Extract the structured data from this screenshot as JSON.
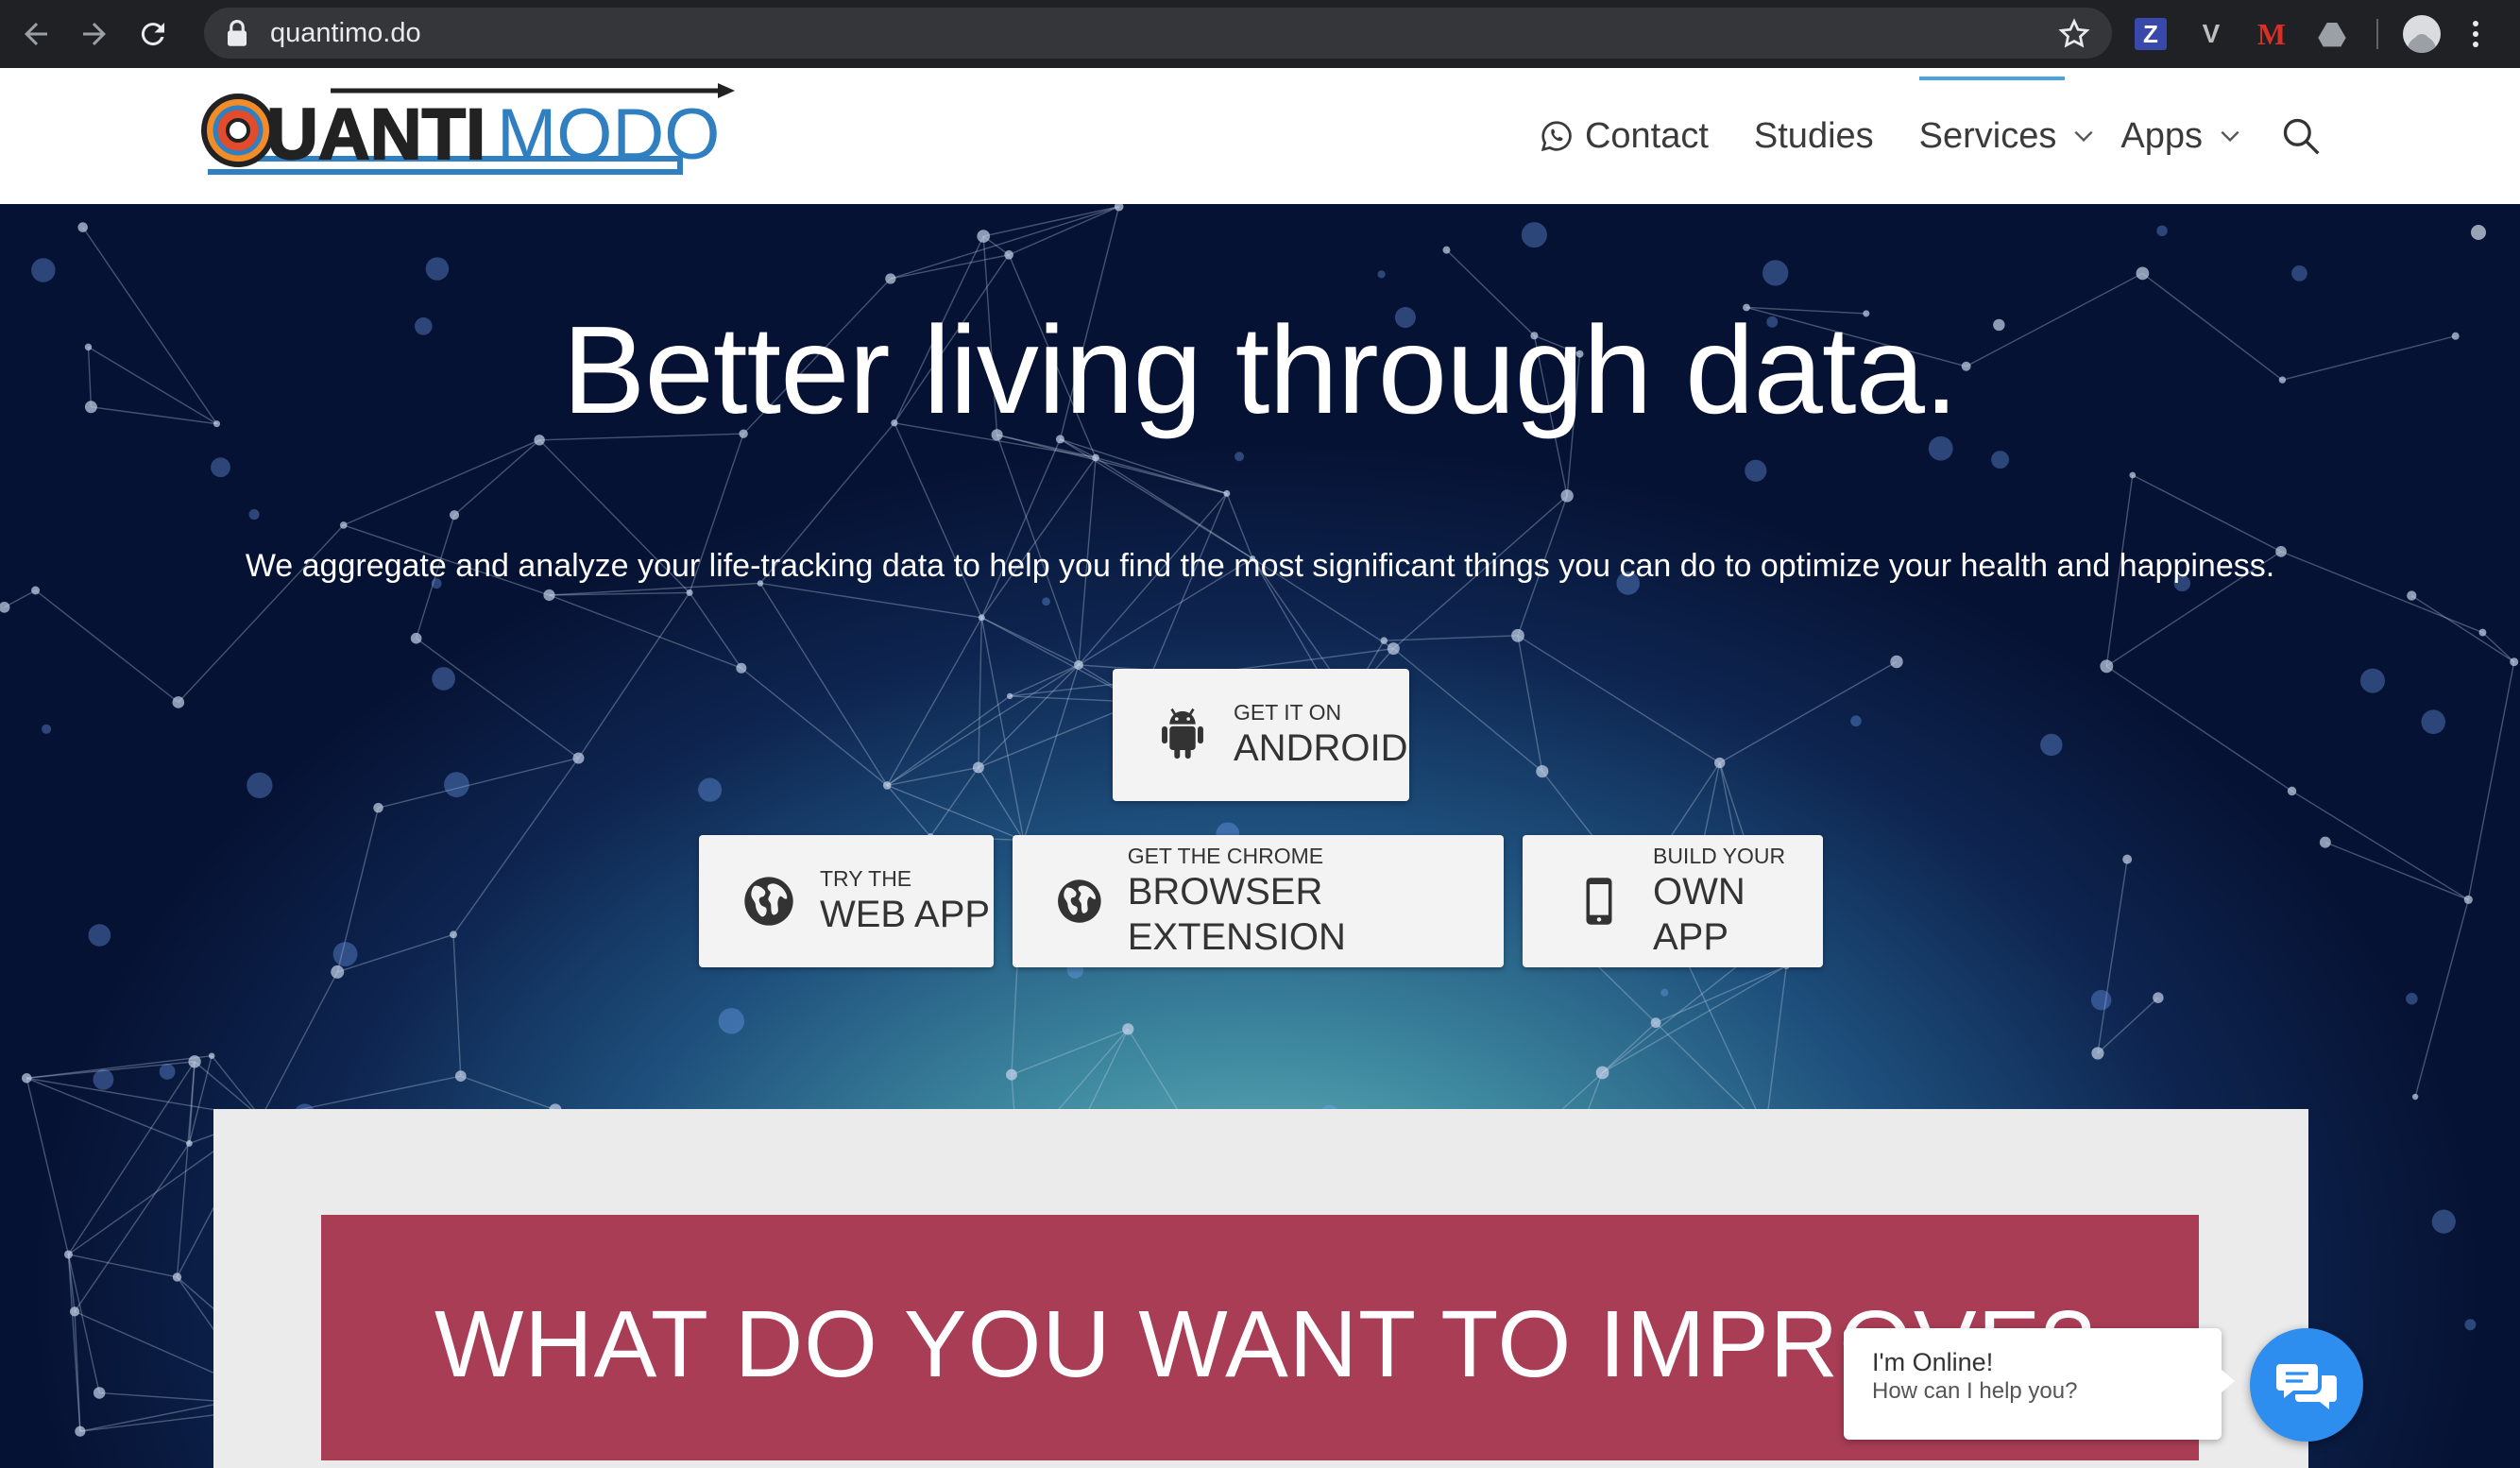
{
  "browser": {
    "url": "quantimo.do",
    "extensions": [
      {
        "name": "z-extension-icon",
        "label": "Z"
      },
      {
        "name": "v-extension-icon",
        "label": "V"
      },
      {
        "name": "gmail-extension-icon",
        "label": "M"
      },
      {
        "name": "drive-extension-icon",
        "label": ""
      }
    ]
  },
  "header": {
    "logo_text": "QUANTIMODO",
    "nav": {
      "contact": "Contact",
      "studies": "Studies",
      "services": "Services",
      "apps": "Apps"
    },
    "active_item": "Services",
    "accent_color": "#4aa3df"
  },
  "hero": {
    "title": "Better living through data.",
    "subtitle": "We aggregate and analyze your life-tracking data to help you find the most significant things you can do to optimize your health and happiness.",
    "buttons": {
      "android": {
        "top": "GET IT ON",
        "main": "ANDROID",
        "icon": "android-icon"
      },
      "web_app": {
        "top": "TRY THE",
        "main": "WEB APP",
        "icon": "globe-icon"
      },
      "chrome": {
        "top": "GET THE CHROME",
        "main": "BROWSER EXTENSION",
        "icon": "globe-icon"
      },
      "own_app": {
        "top": "BUILD YOUR",
        "main": "OWN APP",
        "icon": "phone-icon"
      }
    }
  },
  "banner": {
    "text": "WHAT DO YOU WANT TO IMPROVE?",
    "color": "#a83d55"
  },
  "chat": {
    "title": "I'm Online!",
    "subtitle": "How can I help you?",
    "color": "#2d8ef0"
  }
}
